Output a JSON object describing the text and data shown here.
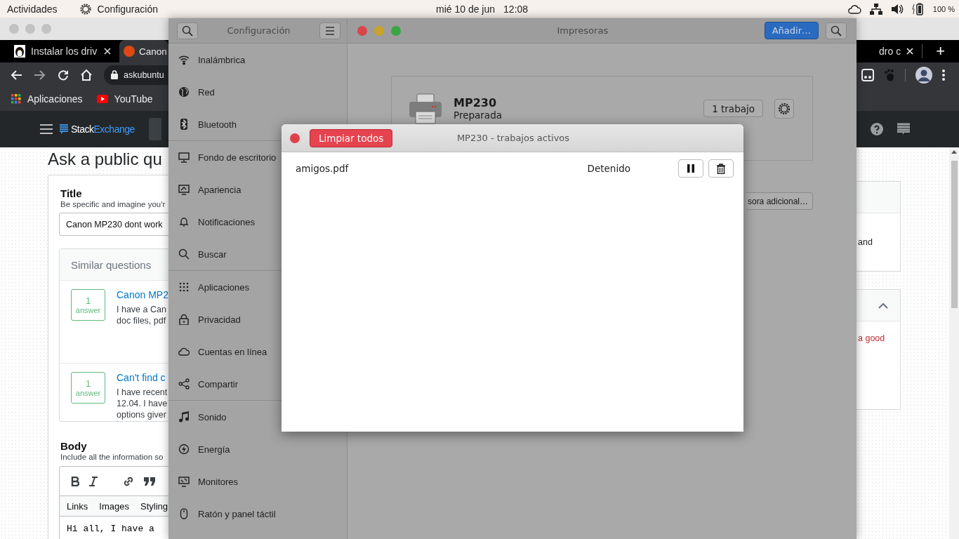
{
  "top_bar": {
    "activities": "Actividades",
    "app_name": "Configuración",
    "date": "mié 10 de jun",
    "time": "12:08",
    "battery": "100 %"
  },
  "browser": {
    "tabs": [
      {
        "label": "Instalar los driv",
        "selected": false,
        "kind": "penguin"
      },
      {
        "label": "Canon",
        "selected": true,
        "kind": "ask"
      }
    ],
    "far_tab": {
      "label": "dro c"
    },
    "new_tab": "+",
    "address": "askubuntu",
    "bookmarks": [
      {
        "label": "Aplicaciones",
        "kind": "apps"
      },
      {
        "label": "YouTube",
        "kind": "youtube"
      }
    ],
    "site_logo": {
      "left": "Stack",
      "right": "Exchange"
    }
  },
  "page": {
    "heading": "Ask a public qu",
    "title_label": "Title",
    "title_hint": "Be specific and imagine you'r",
    "title_value": "Canon MP230 dont work",
    "similar": {
      "heading": "Similar questions",
      "items": [
        {
          "count": "1",
          "unit": "answer",
          "title": "Canon MP2",
          "lines": [
            "I have a Can",
            "doc files, pdf"
          ]
        },
        {
          "count": "1",
          "unit": "answer",
          "title": "Can't find c",
          "lines": [
            "I have recent",
            "12.04. I have",
            "options giver"
          ]
        }
      ]
    },
    "body_label": "Body",
    "body_hint": "Include all the information so",
    "editor_tabs": [
      "Links",
      "Images",
      "Styling"
    ],
    "body_text": "Hi all, I have a",
    "side_cards": [
      {
        "kind": "plain",
        "text": "and"
      },
      {
        "kind": "warning",
        "text": "a good"
      }
    ]
  },
  "settings": {
    "title": "Configuración",
    "groups": [
      [
        {
          "label": "Inalámbrica",
          "kind": "wifi"
        },
        {
          "label": "Red",
          "kind": "globe"
        },
        {
          "label": "Bluetooth",
          "kind": "bluetooth"
        }
      ],
      [
        {
          "label": "Fondo de escritorio",
          "kind": "monitor"
        },
        {
          "label": "Apariencia",
          "kind": "appearance"
        },
        {
          "label": "Notificaciones",
          "kind": "bell"
        },
        {
          "label": "Buscar",
          "kind": "search"
        }
      ],
      [
        {
          "label": "Aplicaciones",
          "kind": "grid"
        },
        {
          "label": "Privacidad",
          "kind": "lock"
        },
        {
          "label": "Cuentas en línea",
          "kind": "cloud"
        },
        {
          "label": "Compartir",
          "kind": "share"
        }
      ],
      [
        {
          "label": "Sonido",
          "kind": "music"
        },
        {
          "label": "Energía",
          "kind": "power"
        },
        {
          "label": "Monitores",
          "kind": "display"
        },
        {
          "label": "Ratón y panel táctil",
          "kind": "mouse"
        }
      ]
    ]
  },
  "printers": {
    "title": "Impresoras",
    "add": "Añadir…",
    "printer": {
      "name": "MP230",
      "status": "Preparada",
      "jobs": "1 trabajo"
    },
    "extra": "sora adicional…"
  },
  "dialog": {
    "title": "MP230 - trabajos activos",
    "clear": "Limpiar todos",
    "jobs": [
      {
        "name": "amigos.pdf",
        "state": "Detenido"
      }
    ]
  }
}
